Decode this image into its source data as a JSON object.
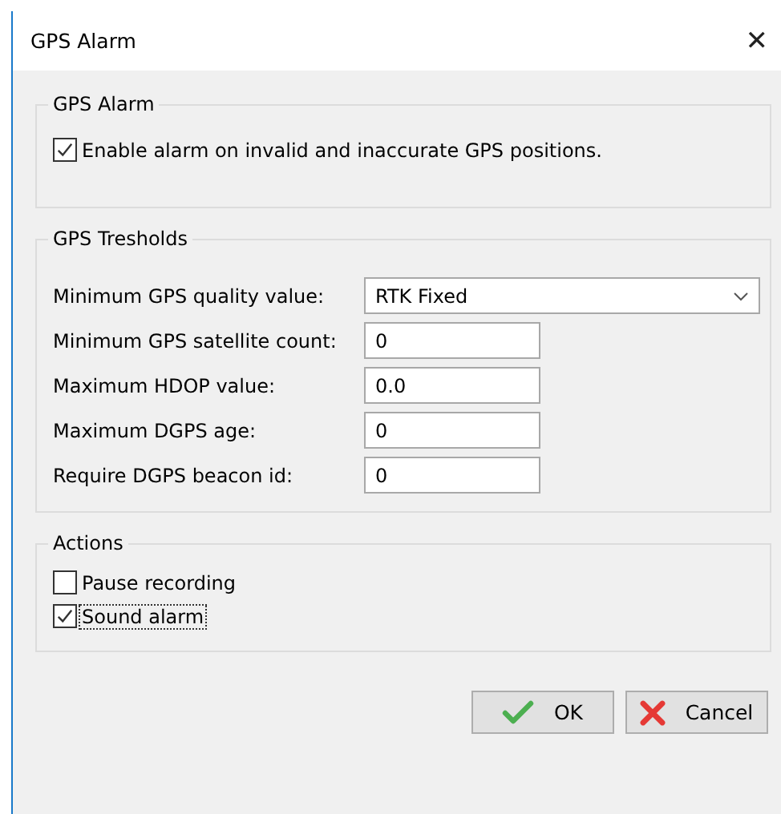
{
  "window": {
    "title": "GPS Alarm",
    "close": "✕"
  },
  "alarm_group": {
    "title": "GPS Alarm",
    "enable": {
      "label": "Enable alarm on invalid and inaccurate GPS positions.",
      "checked": true
    }
  },
  "thresholds_group": {
    "title": "GPS Tresholds",
    "fields": [
      {
        "kind": "dropdown",
        "label": "Minimum GPS quality value:",
        "value": "RTK Fixed"
      },
      {
        "kind": "text",
        "label": "Minimum GPS satellite count:",
        "value": "0"
      },
      {
        "kind": "text",
        "label": "Maximum HDOP value:",
        "value": "0.0"
      },
      {
        "kind": "text",
        "label": "Maximum DGPS age:",
        "value": "0"
      },
      {
        "kind": "text",
        "label": "Require DGPS beacon id:",
        "value": "0"
      }
    ]
  },
  "actions_group": {
    "title": "Actions",
    "options": [
      {
        "label": "Pause recording",
        "checked": false,
        "focused": false
      },
      {
        "label": "Sound alarm",
        "checked": true,
        "focused": true
      }
    ]
  },
  "buttons": [
    {
      "kind": "ok",
      "label": "OK"
    },
    {
      "kind": "cancel",
      "label": "Cancel"
    }
  ]
}
